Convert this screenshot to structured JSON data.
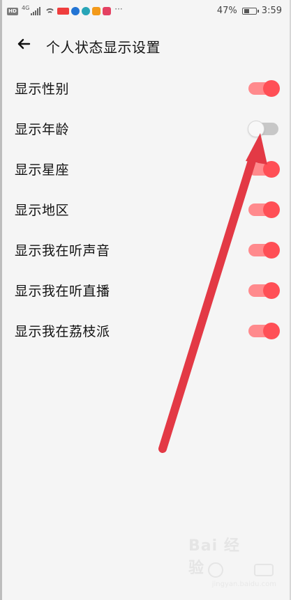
{
  "status_bar": {
    "battery_percent": "47%",
    "time": "3:59",
    "network_label": "4G",
    "more_indicator": "···"
  },
  "header": {
    "title": "个人状态显示设置"
  },
  "settings": [
    {
      "label": "显示性别",
      "enabled": true
    },
    {
      "label": "显示年龄",
      "enabled": false
    },
    {
      "label": "显示星座",
      "enabled": true
    },
    {
      "label": "显示地区",
      "enabled": true
    },
    {
      "label": "显示我在听声音",
      "enabled": true
    },
    {
      "label": "显示我在听直播",
      "enabled": true
    },
    {
      "label": "显示我在荔枝派",
      "enabled": true
    }
  ],
  "colors": {
    "toggle_on_track": "#ff8a8d",
    "toggle_on_knob": "#ff4f56",
    "toggle_off_track": "#c7c7c7",
    "arrow": "#e33945"
  },
  "watermark": {
    "brand_text": "Bai 经验",
    "url": "jingyan.baidu.com"
  }
}
